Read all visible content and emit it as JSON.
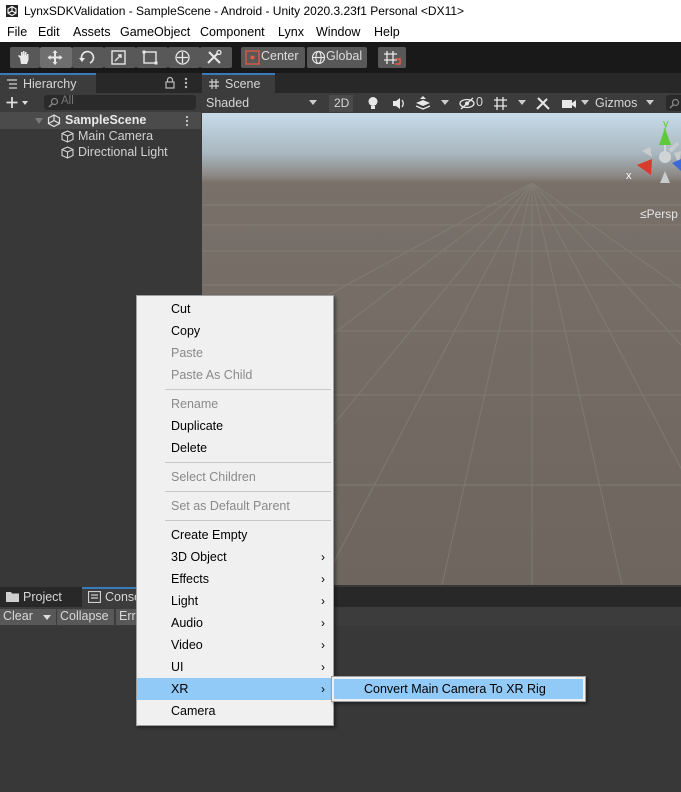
{
  "window": {
    "title": "LynxSDKValidation - SampleScene - Android - Unity 2020.3.23f1 Personal <DX11>"
  },
  "menubar": {
    "items": [
      "File",
      "Edit",
      "Assets",
      "GameObject",
      "Component",
      "Lynx",
      "Window",
      "Help"
    ]
  },
  "toolbar": {
    "pivot_label": "Center",
    "space_label": "Global"
  },
  "hierarchy": {
    "tab_label": "Hierarchy",
    "search_placeholder": "All",
    "scene_name": "SampleScene",
    "objects": [
      "Main Camera",
      "Directional Light"
    ]
  },
  "scene_view": {
    "tab_label": "Scene",
    "shading_mode": "Shaded",
    "mode_2d": "2D",
    "hidden_count": "0",
    "gizmos_label": "Gizmos",
    "projection_label": "Persp",
    "axis_y": "y",
    "axis_x": "x"
  },
  "bottom_panel": {
    "tabs": [
      "Project",
      "Console"
    ],
    "console_tools": [
      "Clear",
      "Collapse",
      "Error Pause"
    ]
  },
  "context_menu": {
    "items": [
      {
        "label": "Cut",
        "enabled": true
      },
      {
        "label": "Copy",
        "enabled": true
      },
      {
        "label": "Paste",
        "enabled": false
      },
      {
        "label": "Paste As Child",
        "enabled": false
      },
      {
        "label": "Rename",
        "enabled": false
      },
      {
        "label": "Duplicate",
        "enabled": true
      },
      {
        "label": "Delete",
        "enabled": true
      },
      {
        "label": "Select Children",
        "enabled": false
      },
      {
        "label": "Set as Default Parent",
        "enabled": false
      },
      {
        "label": "Create Empty",
        "enabled": true
      },
      {
        "label": "3D Object",
        "enabled": true,
        "submenu": true
      },
      {
        "label": "Effects",
        "enabled": true,
        "submenu": true
      },
      {
        "label": "Light",
        "enabled": true,
        "submenu": true
      },
      {
        "label": "Audio",
        "enabled": true,
        "submenu": true
      },
      {
        "label": "Video",
        "enabled": true,
        "submenu": true
      },
      {
        "label": "UI",
        "enabled": true,
        "submenu": true
      },
      {
        "label": "XR",
        "enabled": true,
        "submenu": true,
        "highlighted": true
      },
      {
        "label": "Camera",
        "enabled": true
      }
    ],
    "submenu_arrow": "›"
  },
  "xr_submenu": {
    "items": [
      "Convert Main Camera To XR Rig"
    ]
  },
  "colors": {
    "highlight": "#91c9f7",
    "tab_accent": "#3a79bb",
    "toolbar_bg": "#191919",
    "panel_bg": "#383838"
  }
}
